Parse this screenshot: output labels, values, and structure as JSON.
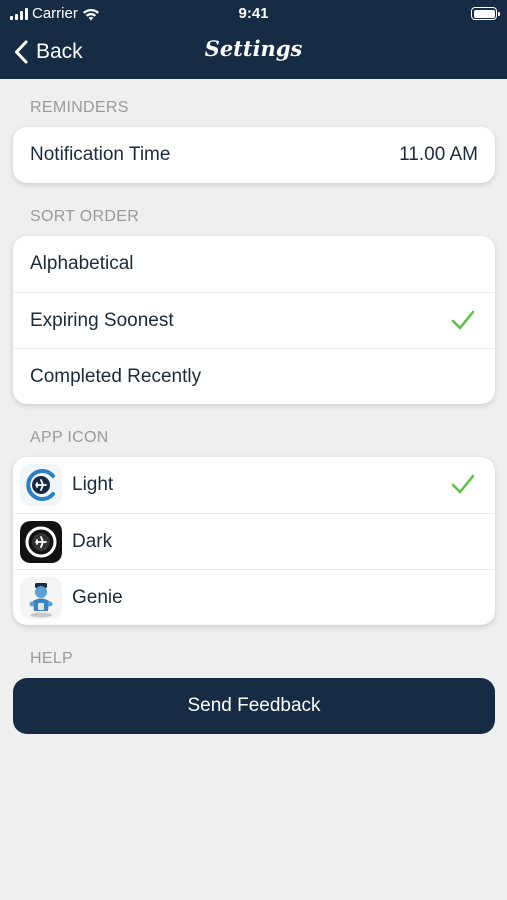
{
  "status_bar": {
    "carrier": "Carrier",
    "time": "9:41"
  },
  "nav": {
    "back_label": "Back",
    "title": "Settings"
  },
  "sections": {
    "reminders": {
      "label": "REMINDERS",
      "notification_time_label": "Notification Time",
      "notification_time_value": "11.00 AM"
    },
    "sort_order": {
      "label": "SORT ORDER",
      "options": [
        "Alphabetical",
        "Expiring Soonest",
        "Completed Recently"
      ],
      "selected": "Expiring Soonest"
    },
    "app_icon": {
      "label": "APP ICON",
      "options": [
        "Light",
        "Dark",
        "Genie"
      ],
      "selected": "Light"
    },
    "help": {
      "label": "HELP",
      "feedback_button": "Send Feedback"
    }
  },
  "colors": {
    "nav_background": "#162b44",
    "page_background": "#efefef",
    "checkmark": "#5cc13c",
    "section_label": "#9a9a9a"
  },
  "icons": [
    "signal-icon",
    "wifi-icon",
    "battery-icon",
    "chevron-left-icon",
    "checkmark-icon",
    "app-icon-light",
    "app-icon-dark",
    "app-icon-genie"
  ]
}
